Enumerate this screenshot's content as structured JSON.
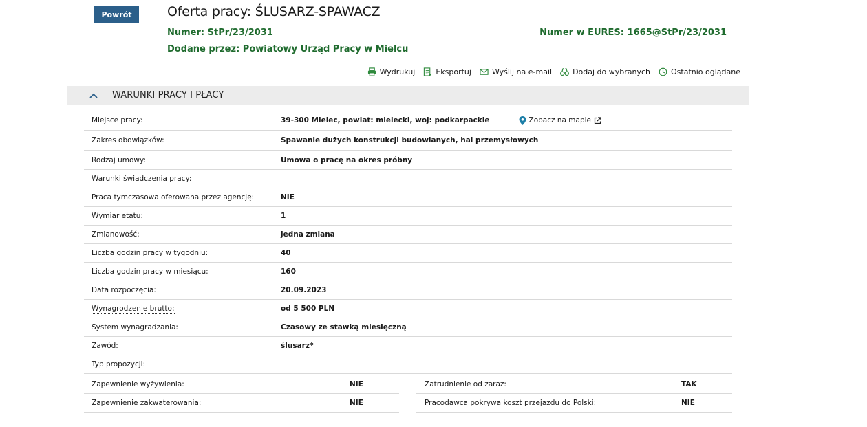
{
  "header": {
    "back_label": "Powrót",
    "title": "Oferta pracy: ŚLUSARZ-SPAWACZ",
    "numer_label": "Numer:",
    "numer_value": "StPr/23/2031",
    "eures_label": "Numer w EURES:",
    "eures_value": "1665@StPr/23/2031",
    "added_label": "Dodane przez:",
    "added_value": "Powiatowy Urząd Pracy w Mielcu"
  },
  "actions": [
    {
      "label": "Wydrukuj",
      "icon": "printer-icon"
    },
    {
      "label": "Eksportuj",
      "icon": "export-icon"
    },
    {
      "label": "Wyślij na e-mail",
      "icon": "mail-icon"
    },
    {
      "label": "Dodaj do wybranych",
      "icon": "binoculars-icon"
    },
    {
      "label": "Ostatnio oglądane",
      "icon": "clock-icon"
    }
  ],
  "section": {
    "title": "WARUNKI PRACY I PŁACY"
  },
  "rows": [
    {
      "key": "Miejsce pracy:",
      "value": "39-300 Mielec, powiat: mielecki, woj: podkarpackie"
    },
    {
      "key": "Zakres obowiązków:",
      "value": "Spawanie dużych konstrukcji budowlanych, hal przemysłowych"
    },
    {
      "key": "Rodzaj umowy:",
      "value": "Umowa o pracę na okres próbny"
    },
    {
      "key": "Warunki świadczenia pracy:",
      "value": ""
    },
    {
      "key": "Praca tymczasowa oferowana przez agencję:",
      "value": "NIE"
    },
    {
      "key": "Wymiar etatu:",
      "value": "1"
    },
    {
      "key": "Zmianowość:",
      "value": "jedna zmiana"
    },
    {
      "key": "Liczba godzin pracy w tygodniu:",
      "value": "40"
    },
    {
      "key": "Liczba godzin pracy w miesiącu:",
      "value": "160"
    },
    {
      "key": "Data rozpoczęcia:",
      "value": "20.09.2023"
    },
    {
      "key": "Wynagrodzenie brutto:",
      "value": "od 5 500 PLN"
    },
    {
      "key": "System wynagradzania:",
      "value": "Czasowy ze stawką miesięczną"
    },
    {
      "key": "Zawód:",
      "value": "ślusarz*"
    },
    {
      "key": "Typ propozycji:",
      "value": ""
    }
  ],
  "map_link": "Zobacz na mapie",
  "split_left": [
    {
      "key": "Zapewnienie wyżywienia:",
      "value": "NIE"
    },
    {
      "key": "Zapewnienie zakwaterowania:",
      "value": "NIE"
    }
  ],
  "split_right": [
    {
      "key": "Zatrudnienie od zaraz:",
      "value": "TAK"
    },
    {
      "key": "Pracodawca pokrywa koszt przejazdu do Polski:",
      "value": "NIE"
    }
  ],
  "colors": {
    "accent_blue": "#2b5f8a",
    "green_text": "#1f6b2e",
    "header_bg": "#ececec",
    "map_pin": "#1d7fa8"
  }
}
